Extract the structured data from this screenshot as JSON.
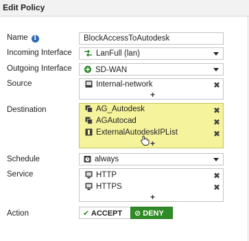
{
  "window": {
    "title": "Edit Policy"
  },
  "labels": {
    "name": "Name",
    "incoming": "Incoming Interface",
    "outgoing": "Outgoing Interface",
    "source": "Source",
    "destination": "Destination",
    "schedule": "Schedule",
    "service": "Service",
    "action": "Action"
  },
  "name_value": "BlockAccessToAutodesk",
  "incoming_interface": {
    "value": "LanFull (lan)",
    "icon": "interface-link-icon"
  },
  "outgoing_interface": {
    "value": "SD-WAN",
    "icon": "sd-wan-icon"
  },
  "source": {
    "items": [
      "Internal-network"
    ],
    "add": "+"
  },
  "destination": {
    "items": [
      "AG_Autodesk",
      "AGAutocad",
      "ExternalAutodeskIPList"
    ],
    "add": "+",
    "highlight_color": "#f5f39c"
  },
  "schedule": {
    "value": "always"
  },
  "service": {
    "items": [
      "HTTP",
      "HTTPS"
    ],
    "add": "+"
  },
  "action": {
    "accept": "ACCEPT",
    "deny": "DENY",
    "selected": "DENY",
    "deny_color": "#2e8b26"
  },
  "remove_glyph": "✖"
}
